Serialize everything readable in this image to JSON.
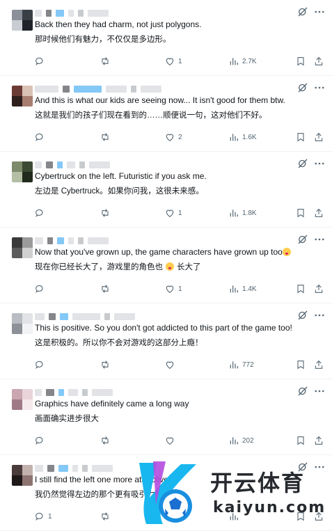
{
  "replies": [
    {
      "original_text": "Back then they had charm, not just polygons.",
      "translated_text": "那时候他们有魅力，不仅仅是多边形。",
      "reply_count": "",
      "repost_count": "",
      "like_count": "1",
      "view_count": "2.7K",
      "emoji": false
    },
    {
      "original_text": "And this is what our kids are seeing now... It isn't good for them btw.",
      "translated_text": "这就是我们的孩子们现在看到的……顺便说一句，这对他们不好。",
      "reply_count": "",
      "repost_count": "",
      "like_count": "2",
      "view_count": "1.6K",
      "emoji": false
    },
    {
      "original_text": "Cybertruck on the left. Futuristic if you ask me.",
      "translated_text": "左边是 Cybertruck。如果你问我，这很未来感。",
      "reply_count": "",
      "repost_count": "",
      "like_count": "1",
      "view_count": "1.8K",
      "emoji": false
    },
    {
      "original_text": "Now that you've grown up, the game characters have grown up too",
      "translated_text": "现在你已经长大了，游戏里的角色也",
      "translated_text_after": "长大了",
      "reply_count": "",
      "repost_count": "",
      "like_count": "1",
      "view_count": "1.4K",
      "emoji": true
    },
    {
      "original_text": "This is positive. So you don't got addicted to this part of the game too!",
      "translated_text": "这是积极的。所以你不会对游戏的这部分上瘾！",
      "reply_count": "",
      "repost_count": "",
      "like_count": "",
      "view_count": "772",
      "emoji": false
    },
    {
      "original_text": "Graphics have definitely came a long way",
      "translated_text": "画面确实进步很大",
      "reply_count": "",
      "repost_count": "",
      "like_count": "",
      "view_count": "202",
      "emoji": false
    },
    {
      "original_text": "I still find the left one more attractive",
      "translated_text": "我仍然觉得左边的那个更有吸引力",
      "reply_count": "1",
      "repost_count": "",
      "like_count": "",
      "view_count": "",
      "emoji": false
    }
  ],
  "watermark": {
    "brand_cn": "开云体育",
    "brand_en": "kaiyun.com"
  },
  "colors": {
    "text": "#0f1419",
    "muted": "#536471",
    "divider": "#eff3f4",
    "blur_blue": "#1d9bf0"
  },
  "icons": [
    "reply-icon",
    "repost-icon",
    "like-icon",
    "views-icon",
    "bookmark-icon",
    "share-icon",
    "translate-icon",
    "more-icon"
  ]
}
